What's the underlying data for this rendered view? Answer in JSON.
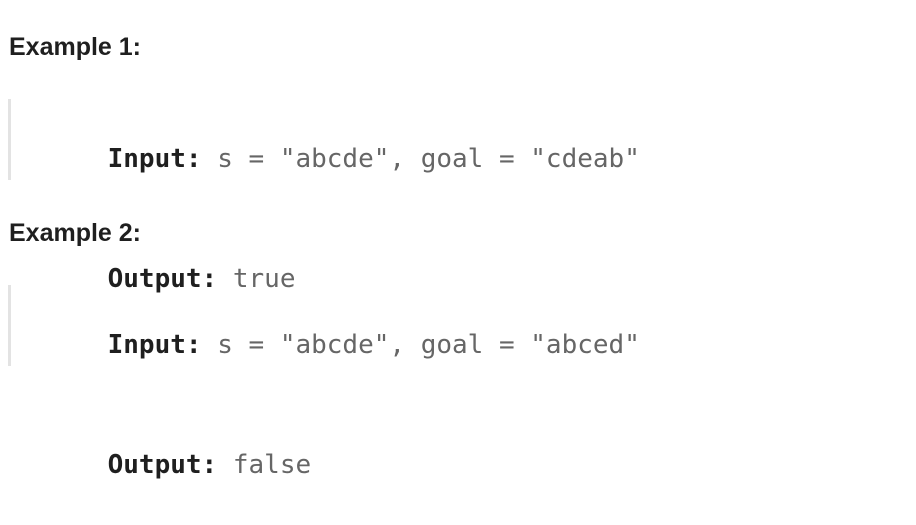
{
  "examples": [
    {
      "heading": "Example 1:",
      "input_label": "Input:",
      "input_value": "s = \"abcde\", goal = \"cdeab\"",
      "output_label": "Output:",
      "output_value": "true"
    },
    {
      "heading": "Example 2:",
      "input_label": "Input:",
      "input_value": "s = \"abcde\", goal = \"abced\"",
      "output_label": "Output:",
      "output_value": "false"
    }
  ]
}
